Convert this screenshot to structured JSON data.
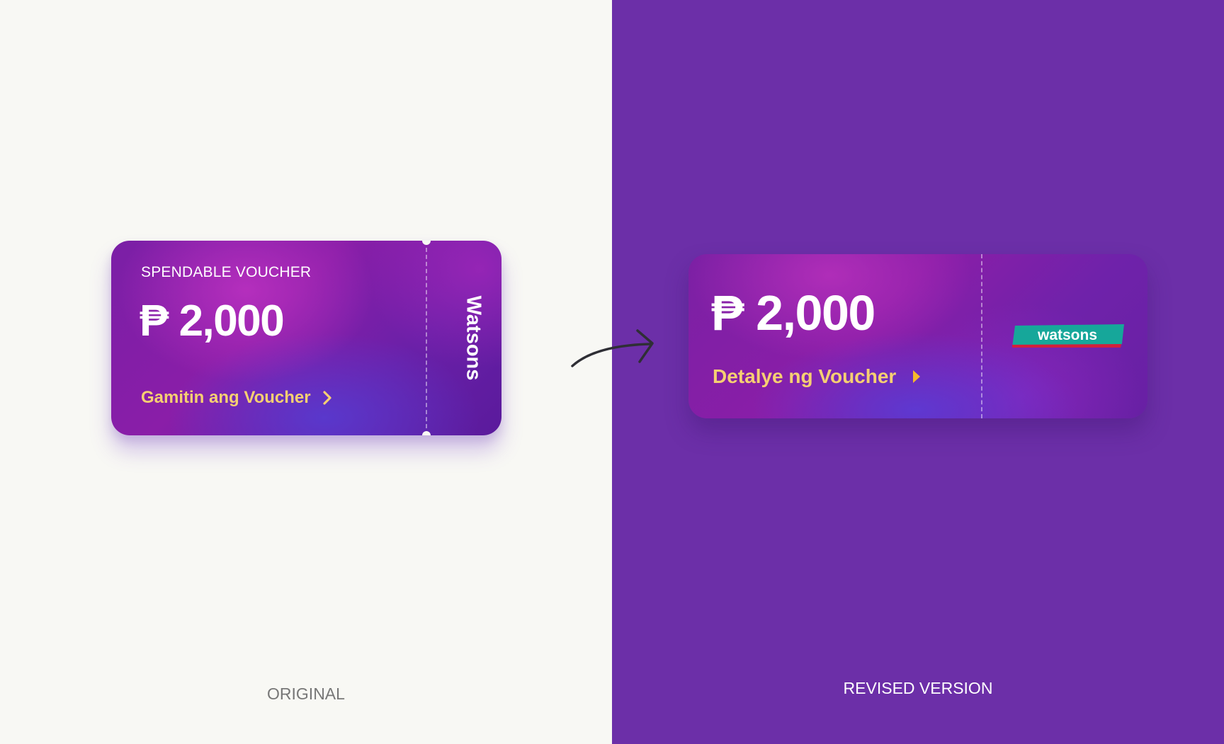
{
  "original": {
    "label": "SPENDABLE VOUCHER",
    "amount": "₱ 2,000",
    "action_label": "Gamitin ang Voucher",
    "brand": "Watsons",
    "caption": "ORIGINAL"
  },
  "revised": {
    "amount": "₱ 2,000",
    "action_label": "Detalye ng Voucher",
    "logo_text": "watsons",
    "caption": "REVISED VERSION"
  },
  "colors": {
    "left_background": "#f8f8f4",
    "right_background": "#6c2fa8",
    "voucher_purple": "#7a1fa6",
    "action_yellow": "#f6cf72",
    "logo_teal": "#16a79a",
    "logo_red": "#d21f3c"
  },
  "icons": {
    "original_action": "chevron-right-icon",
    "revised_action": "caret-right-icon",
    "transition": "curved-arrow-icon"
  }
}
